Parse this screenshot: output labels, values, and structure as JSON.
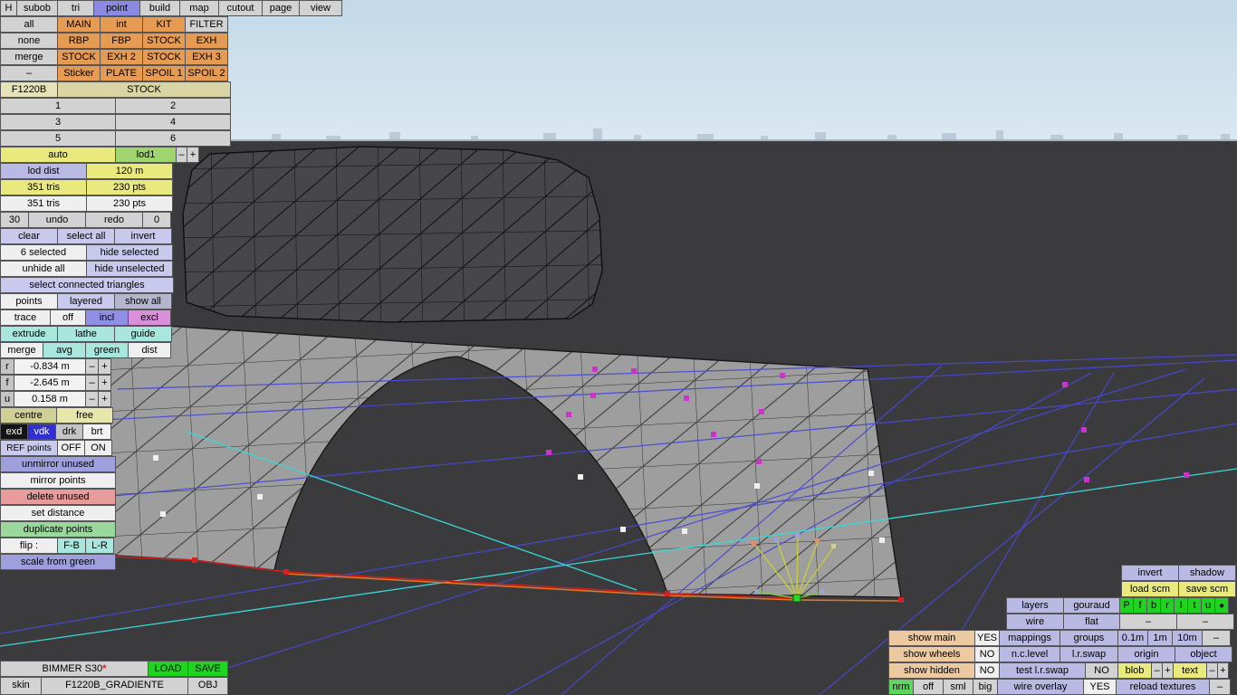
{
  "menu": {
    "h": "H",
    "subob": "subob",
    "tri": "tri",
    "point": "point",
    "build": "build",
    "map": "map",
    "cutout": "cutout",
    "page": "page",
    "view": "view"
  },
  "parts": {
    "all": "all",
    "main": "MAIN",
    "int": "int",
    "kit": "KIT",
    "filter": "FILTER",
    "none": "none",
    "rbp": "RBP",
    "fbp": "FBP",
    "stock1": "STOCK",
    "exh": "EXH",
    "merge": "merge",
    "stock2": "STOCK",
    "exh2": "EXH 2",
    "stock3": "STOCK",
    "exh3": "EXH 3",
    "dash": "–",
    "sticker": "Sticker",
    "plate": "PLATE",
    "spoil1": "SPOIL 1",
    "spoil2": "SPOIL 2",
    "model": "F1220B",
    "config": "STOCK",
    "p1": "1",
    "p2": "2",
    "p3": "3",
    "p4": "4",
    "p5": "5",
    "p6": "6"
  },
  "lod": {
    "auto": "auto",
    "current": "lod1",
    "minus": "–",
    "plus": "+",
    "dist_label": "lod dist",
    "dist_value": "120 m",
    "tris_sel": "351 tris",
    "pts_sel": "230 pts",
    "tris_total": "351 tris",
    "pts_total": "230 pts"
  },
  "edit": {
    "undo_count": "30",
    "undo": "undo",
    "redo": "redo",
    "redo_count": "0",
    "clear": "clear",
    "select_all": "select all",
    "invert": "invert",
    "selected_count": "6 selected",
    "hide_selected": "hide selected",
    "unhide_all": "unhide all",
    "hide_unselected": "hide unselected",
    "select_connected": "select connected triangles",
    "points": "points",
    "layered": "layered",
    "show_all": "show all",
    "trace": "trace",
    "off": "off",
    "incl": "incl",
    "excl": "excl",
    "extrude": "extrude",
    "lathe": "lathe",
    "guide": "guide",
    "merge": "merge",
    "avg": "avg",
    "green": "green",
    "dist": "dist"
  },
  "coords": {
    "r_label": "r",
    "r_value": "-0.834 m",
    "f_label": "f",
    "f_value": "-2.645 m",
    "u_label": "u",
    "u_value": "0.158 m",
    "minus": "–",
    "plus": "+",
    "centre": "centre",
    "free": "free",
    "exd": "exd",
    "vdk": "vdk",
    "drk": "drk",
    "brt": "brt",
    "ref_label": "REF points",
    "ref_off": "OFF",
    "ref_on": "ON"
  },
  "point_tools": {
    "unmirror_unused": "unmirror unused",
    "mirror_points": "mirror points",
    "delete_unused": "delete unused",
    "set_distance": "set distance",
    "duplicate_points": "duplicate points",
    "flip_label": "flip :",
    "flip_fb": "F-B",
    "flip_lr": "L-R",
    "scale_from_green": "scale from green"
  },
  "file": {
    "vehicle": "BIMMER S30",
    "modified": "*",
    "load": "LOAD",
    "save": "SAVE",
    "skin_label": "skin",
    "skin_name": "F1220B_GRADIENTE",
    "obj": "OBJ"
  },
  "right": {
    "invert": "invert",
    "shadow": "shadow",
    "load_scm": "load scm",
    "save_scm": "save scm",
    "layers": "layers",
    "gouraud": "gouraud",
    "wire": "wire",
    "flat": "flat",
    "dash": "–",
    "minus": "–",
    "plus": "+",
    "views": [
      "P",
      "f",
      "b",
      "r",
      "l",
      "t",
      "u",
      "●"
    ],
    "show_main": "show main",
    "show_main_val": "YES",
    "mappings": "mappings",
    "groups": "groups",
    "grid_01": "0.1m",
    "grid_1": "1m",
    "grid_10": "10m",
    "show_wheels": "show wheels",
    "show_wheels_val": "NO",
    "nc_level": "n.c.level",
    "lr_swap": "l.r.swap",
    "origin": "origin",
    "object": "object",
    "show_hidden": "show hidden",
    "show_hidden_val": "NO",
    "test_lr_swap": "test l.r.swap",
    "test_lr_swap_val": "NO",
    "blob": "blob",
    "text": "text",
    "nrm": "nrm",
    "off": "off",
    "sml": "sml",
    "big": "big",
    "wire_overlay": "wire overlay",
    "wire_overlay_val": "YES",
    "reload_textures": "reload textures"
  },
  "viewport": {
    "selected_point_color": "#2ad42a",
    "point_color": "#cc33cc",
    "grid_color": "#4848d4",
    "guide_color": "#38d8d8",
    "edge_red": "#cc2020",
    "edge_orange": "#e07820"
  }
}
